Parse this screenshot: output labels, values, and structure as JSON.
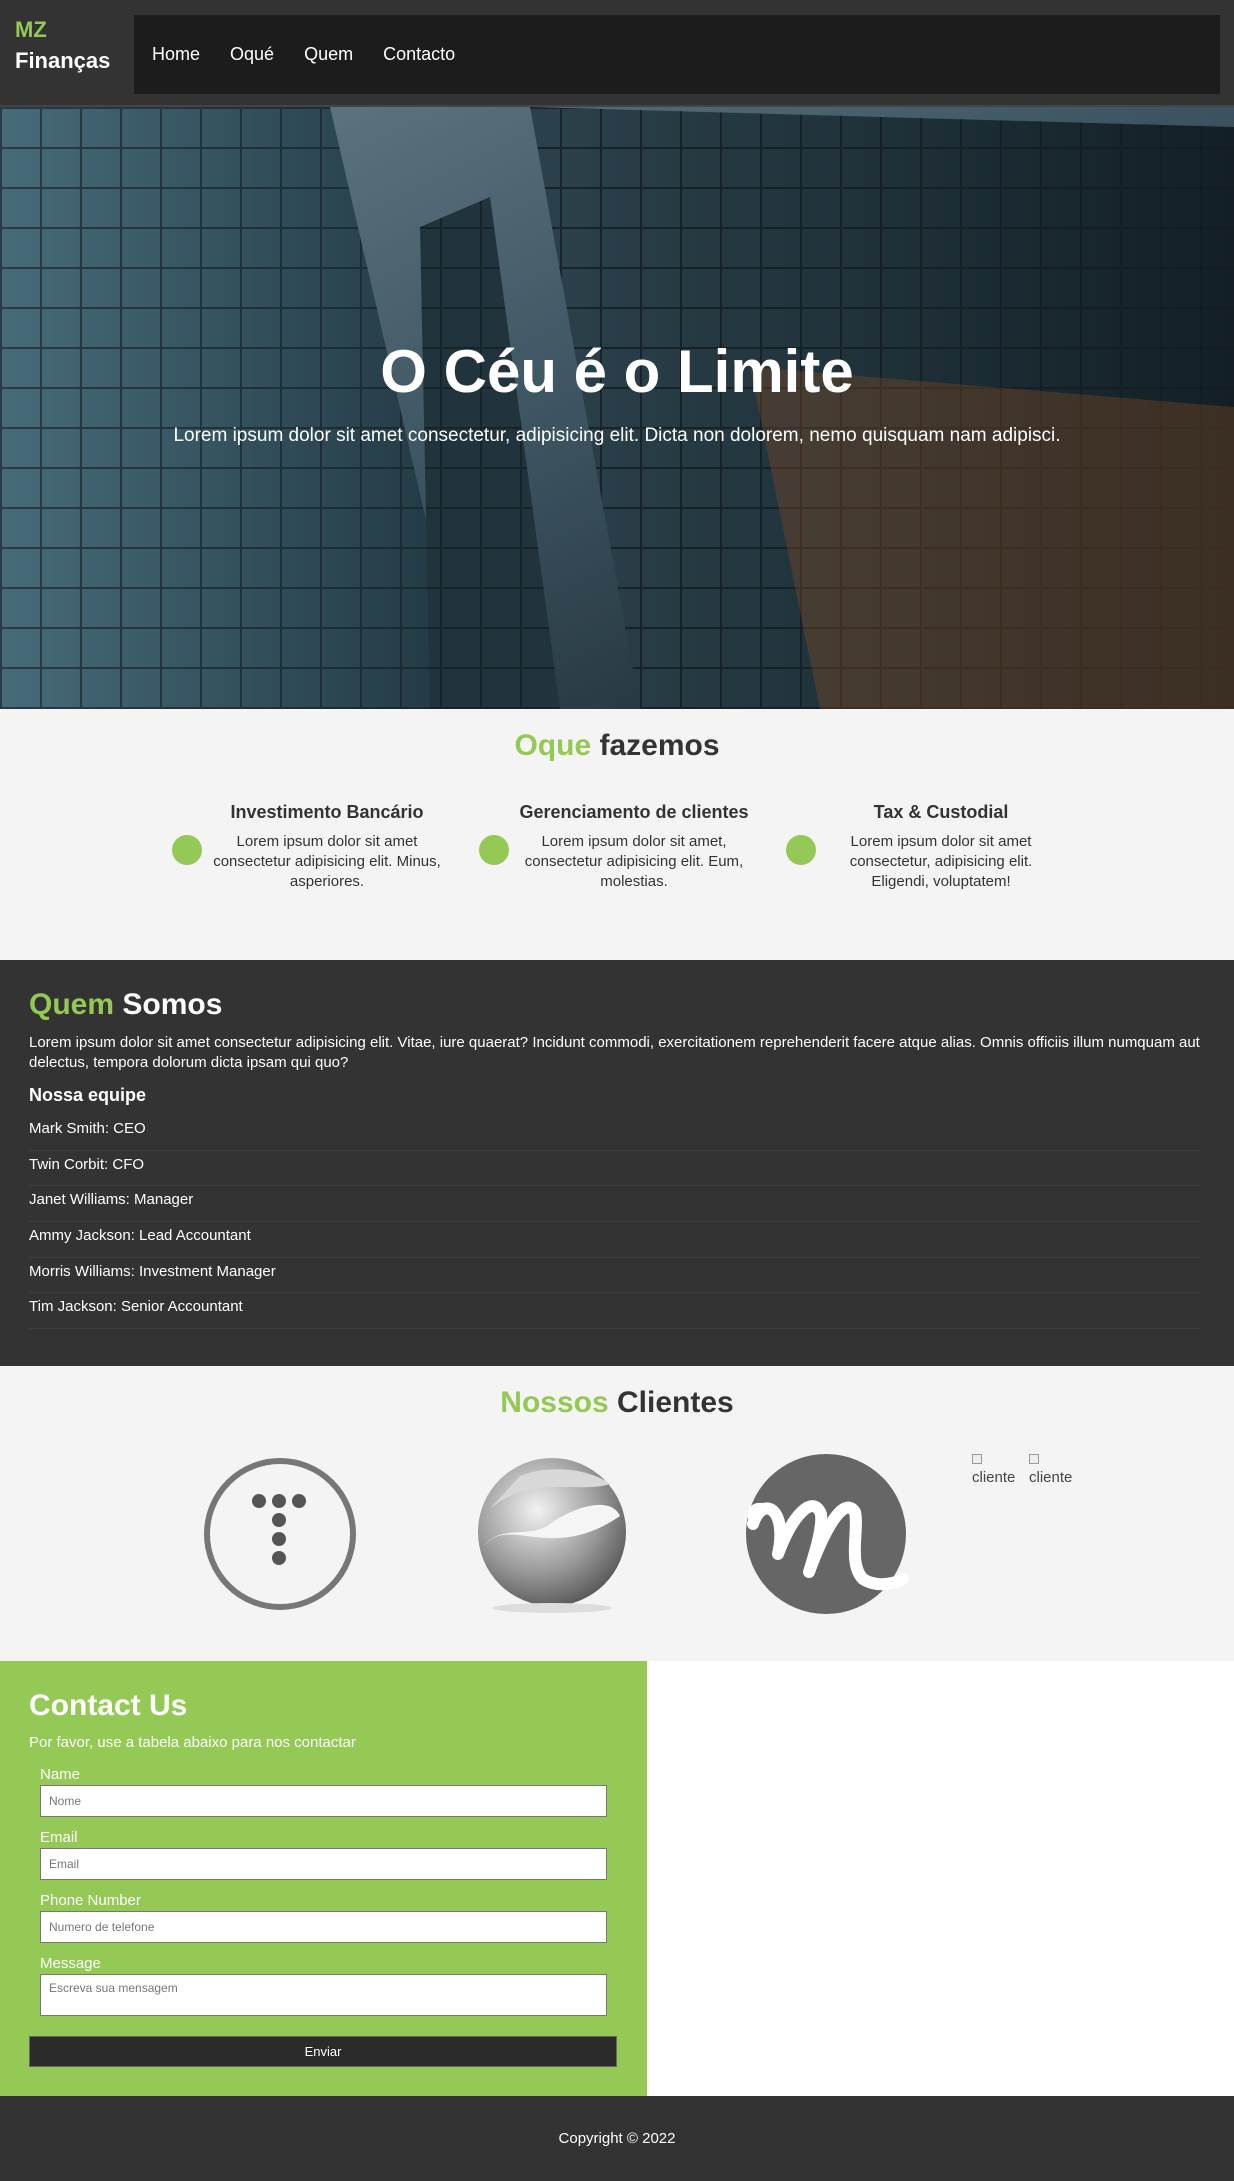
{
  "brand": {
    "line1": "MZ",
    "line2": "Finanças",
    "accent_color": "#93c954"
  },
  "nav": {
    "items": [
      "Home",
      "Oqué",
      "Quem",
      "Contacto"
    ]
  },
  "hero": {
    "title": "O Céu é o Limite",
    "text": "Lorem ipsum dolor sit amet consectetur, adipisicing elit. Dicta non dolorem, nemo quisquam nam adipisci."
  },
  "services": {
    "title_accent": "Oque",
    "title_rest": " fazemos",
    "items": [
      {
        "title": "Investimento Bancário",
        "text": "Lorem ipsum dolor sit amet consectetur adipisicing elit. Minus, asperiores."
      },
      {
        "title": "Gerenciamento de clientes",
        "text": "Lorem ipsum dolor sit amet, consectetur adipisicing elit. Eum, molestias."
      },
      {
        "title": "Tax & Custodial",
        "text": "Lorem ipsum dolor sit amet consectetur, adipisicing elit. Eligendi, voluptatem!"
      }
    ]
  },
  "about": {
    "title_accent": "Quem",
    "title_rest": " Somos",
    "text": "Lorem ipsum dolor sit amet consectetur adipisicing elit. Vitae, iure quaerat? Incidunt commodi, exercitationem reprehenderit facere atque alias. Omnis officiis illum numquam aut delectus, tempora dolorum dicta ipsam qui quo?",
    "team_title": "Nossa equipe",
    "team": [
      "Mark Smith: CEO",
      "Twin Corbit: CFO",
      "Janet Williams: Manager",
      "Ammy Jackson: Lead Accountant",
      "Morris Williams: Investment Manager",
      "Tim Jackson: Senior Accountant"
    ]
  },
  "clients": {
    "title_accent": "Nossos",
    "title_rest": " Clientes",
    "broken_alt": [
      "cliente",
      "cliente"
    ]
  },
  "contact": {
    "title": "Contact Us",
    "subtitle": "Por favor, use a tabela abaixo para nos contactar",
    "fields": [
      {
        "label": "Name",
        "placeholder": "Nome"
      },
      {
        "label": "Email",
        "placeholder": "Email"
      },
      {
        "label": "Phone Number",
        "placeholder": "Numero de telefone"
      },
      {
        "label": "Message",
        "placeholder": "Escreva sua mensagem"
      }
    ],
    "submit": "Enviar"
  },
  "footer": {
    "text": "Copyright © 2022"
  }
}
